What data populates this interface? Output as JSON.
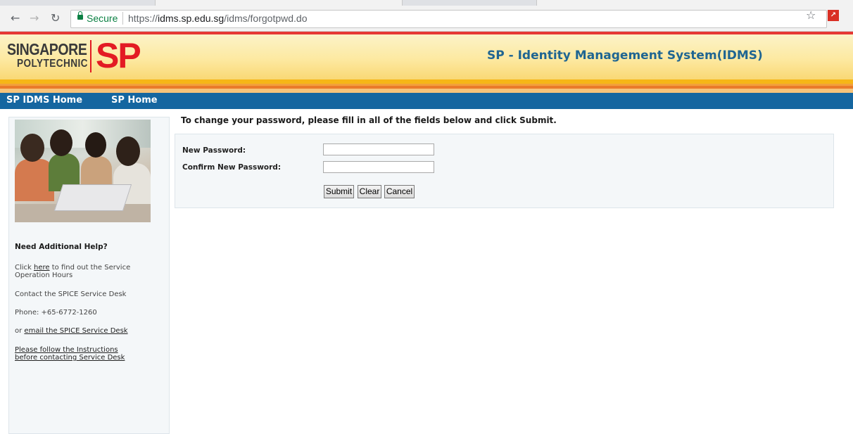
{
  "browser": {
    "security_label": "Secure",
    "url_scheme": "https://",
    "url_host": "idms.sp.edu.sg",
    "url_path": "/idms/forgotpwd.do",
    "nav_icons": {
      "back": "back-arrow-icon",
      "forward": "forward-arrow-icon",
      "reload": "reload-icon"
    },
    "icons": {
      "bookmark": "star-icon",
      "extension": "pdf-extension-icon"
    }
  },
  "header": {
    "logo_line1": "SINGAPORE",
    "logo_line2": "POLYTECHNIC",
    "logo_mark": "SP",
    "title": "SP - Identity Management System(IDMS)",
    "brand_red": "#e31b23",
    "title_color": "#1f6592"
  },
  "nav": {
    "items": [
      {
        "label": "SP IDMS Home"
      },
      {
        "label": "SP Home"
      }
    ],
    "background": "#1566a0"
  },
  "sidebar": {
    "help_title": "Need Additional Help?",
    "hours_prefix": "Click ",
    "hours_link": "here",
    "hours_suffix": " to find out the Service",
    "hours_line2": "Operation Hours",
    "contact": "Contact the SPICE Service Desk",
    "phone": "Phone: +65-6772-1260",
    "email_prefix": "or ",
    "email_link": "email the SPICE Service Desk",
    "instructions_line1": "Please follow the Instructions",
    "instructions_line2": "before contacting Service Desk"
  },
  "main": {
    "instruction": "To change your password, please fill in all of the fields below and click Submit.",
    "new_password_label": "New Password:",
    "confirm_password_label": "Confirm New Password:",
    "new_password_value": "",
    "confirm_password_value": "",
    "buttons": {
      "submit": "Submit",
      "clear": "Clear",
      "cancel": "Cancel"
    }
  }
}
